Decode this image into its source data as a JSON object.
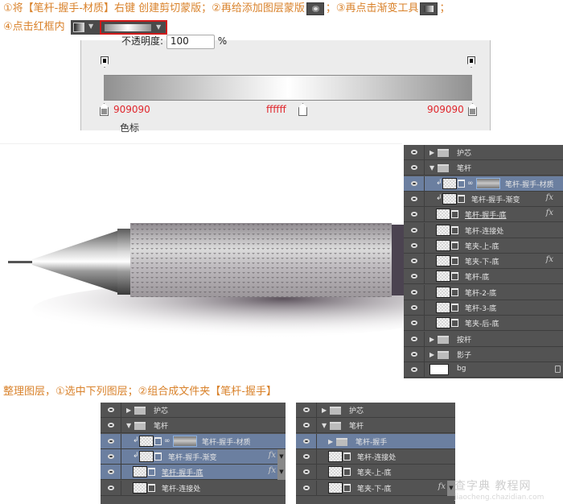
{
  "instructions": {
    "step_line1_a": "①将【笔杆-握手-材质】右键 创建剪切蒙版；②再给添加图层蒙版",
    "step_line1_b": "；③再点击渐变工具",
    "step_line1_c": "；",
    "step_line2": "④点击红框内",
    "regroup": "整理图层，①选中下列图层；②组合成文件夹【笔杆-握手】"
  },
  "icons": {
    "layer_mask_button": "add-layer-mask-icon",
    "gradient_tool": "gradient-tool-icon",
    "gradient_picker": "gradient-picker-swatch"
  },
  "gradient_editor": {
    "opacity_label": "不透明度:",
    "opacity_value": "100",
    "opacity_unit": "%",
    "section_label": "色标",
    "stops": [
      {
        "label": "909090",
        "position": 0,
        "color": "#909090"
      },
      {
        "label": "ffffff",
        "position": 50,
        "color": "#ffffff"
      },
      {
        "label": "909090",
        "position": 100,
        "color": "#909090"
      }
    ],
    "label_color": "#e0262c"
  },
  "layers_panel_main": {
    "rows": [
      {
        "name": "护芯",
        "type": "group",
        "expanded": false,
        "indent": 0,
        "selected": false
      },
      {
        "name": "笔杆",
        "type": "group",
        "expanded": true,
        "indent": 0,
        "selected": false
      },
      {
        "name": "笔杆-握手-材质",
        "type": "clipped-masked",
        "indent": 2,
        "selected": true
      },
      {
        "name": "笔杆-握手-渐变",
        "type": "clipped-shape",
        "indent": 2,
        "selected": false,
        "fx": true
      },
      {
        "name": "笔杆-握手-底",
        "type": "shape",
        "indent": 1,
        "selected": false,
        "fx": true,
        "underline": true
      },
      {
        "name": "笔杆-连接处",
        "type": "shape",
        "indent": 1,
        "selected": false
      },
      {
        "name": "笔夹-上-底",
        "type": "shape",
        "indent": 1,
        "selected": false
      },
      {
        "name": "笔夹-下-底",
        "type": "shape",
        "indent": 1,
        "selected": false,
        "fx": true
      },
      {
        "name": "笔杆-底",
        "type": "shape",
        "indent": 1,
        "selected": false
      },
      {
        "name": "笔杆-2-底",
        "type": "shape",
        "indent": 1,
        "selected": false
      },
      {
        "name": "笔杆-3-底",
        "type": "shape",
        "indent": 1,
        "selected": false
      },
      {
        "name": "笔夹-后-底",
        "type": "shape",
        "indent": 1,
        "selected": false
      },
      {
        "name": "按杆",
        "type": "group",
        "expanded": false,
        "indent": 0,
        "selected": false
      },
      {
        "name": "影子",
        "type": "group",
        "expanded": false,
        "indent": 0,
        "selected": false
      },
      {
        "name": "bg",
        "type": "background",
        "indent": 0,
        "selected": false,
        "locked": true
      }
    ]
  },
  "layers_panel_before": {
    "rows": [
      {
        "name": "护芯"
      },
      {
        "name": "笔杆"
      },
      {
        "name": "笔杆-握手-材质",
        "fx": "",
        "selected": true
      },
      {
        "name": "笔杆-握手-渐变",
        "fx": "fx",
        "selected": true
      },
      {
        "name": "笔杆-握手-底",
        "fx": "fx",
        "selected": true
      },
      {
        "name": "笔杆-连接处"
      }
    ]
  },
  "layers_panel_after": {
    "rows": [
      {
        "name": "护芯"
      },
      {
        "name": "笔杆"
      },
      {
        "name": "笔杆-握手",
        "selected": true
      },
      {
        "name": "笔杆-连接处"
      },
      {
        "name": "笔夹-上-底"
      },
      {
        "name": "笔夹-下-底",
        "fx": "fx"
      }
    ]
  },
  "watermark": {
    "line1": "查字典 教程网",
    "line2": "jiaocheng.chazidian.com"
  }
}
